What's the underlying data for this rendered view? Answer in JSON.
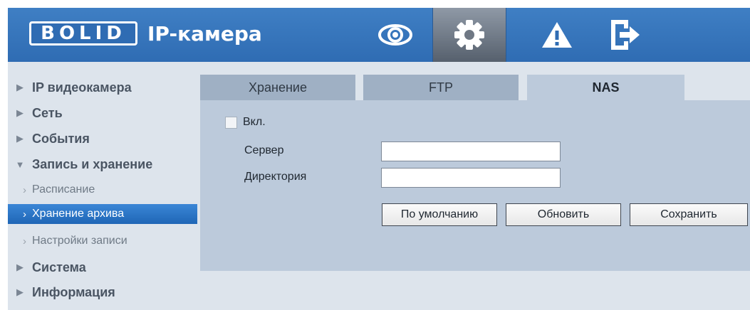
{
  "header": {
    "logo_text": "BOLID",
    "app_title": "IP-камера",
    "buttons": [
      {
        "icon": "eye-icon",
        "name": "live-view"
      },
      {
        "icon": "gear-icon",
        "name": "settings",
        "active": true
      },
      {
        "icon": "warning-icon",
        "name": "alarm"
      },
      {
        "icon": "logout-icon",
        "name": "logout"
      }
    ]
  },
  "sidebar": {
    "items": [
      {
        "label": "IP видеокамера",
        "expanded": false
      },
      {
        "label": "Сеть",
        "expanded": false
      },
      {
        "label": "События",
        "expanded": false
      },
      {
        "label": "Запись и хранение",
        "expanded": true
      },
      {
        "label": "Система",
        "expanded": false
      },
      {
        "label": "Информация",
        "expanded": false
      }
    ],
    "subitems": [
      {
        "label": "Расписание",
        "active": false
      },
      {
        "label": "Хранение архива",
        "active": true
      },
      {
        "label": "Настройки записи",
        "active": false
      }
    ]
  },
  "tabs": [
    {
      "label": "Хранение",
      "active": false
    },
    {
      "label": "FTP",
      "active": false
    },
    {
      "label": "NAS",
      "active": true
    }
  ],
  "form": {
    "enable_label": "Вкл.",
    "enable_checked": false,
    "server_label": "Сервер",
    "server_value": "",
    "directory_label": "Директория",
    "directory_value": "",
    "buttons": {
      "default": "По умолчанию",
      "refresh": "Обновить",
      "save": "Сохранить"
    }
  },
  "colors": {
    "header_blue": "#2f6cb3",
    "sidebar_bg": "#dde4ec",
    "panel_bg": "#bccadb",
    "active_item": "#1f66b6"
  }
}
